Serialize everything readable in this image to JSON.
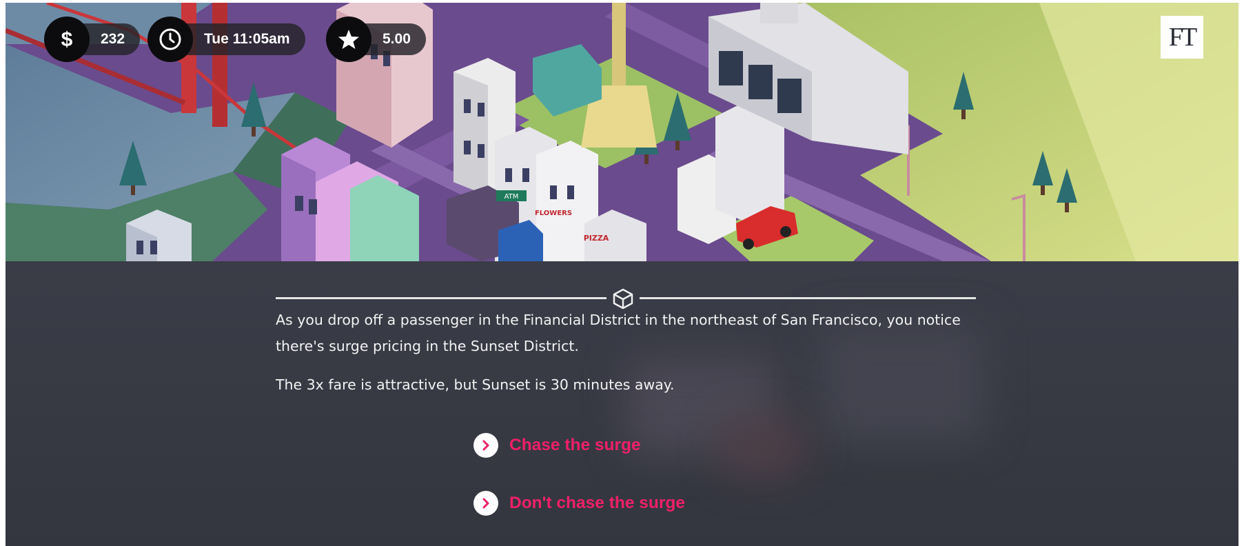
{
  "hud": {
    "money": "232",
    "time": "Tue 11:05am",
    "rating": "5.00"
  },
  "logo": {
    "text": "FT"
  },
  "scene_signs": {
    "atm": "ATM",
    "flowers": "FLOWERS",
    "pizza": "PIZZA"
  },
  "story": {
    "paragraph1": "As you drop off a passenger in the Financial District in the northeast of San Francisco, you notice there's surge pricing in the Sunset District.",
    "paragraph2": "The 3x fare is attractive, but Sunset is 30 minutes away."
  },
  "choices": [
    {
      "label": "Chase the surge"
    },
    {
      "label": "Don't chase the surge"
    }
  ],
  "icons": {
    "money": "dollar-icon",
    "time": "clock-icon",
    "rating": "star-icon",
    "divider": "cube-icon",
    "choice": "chevron-right-icon"
  },
  "colors": {
    "accent": "#ee2068",
    "panel": "#383a45",
    "text": "#f3f3f3"
  }
}
